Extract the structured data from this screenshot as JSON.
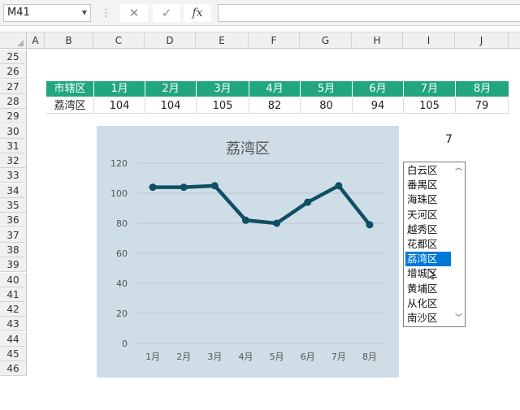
{
  "formula_bar": {
    "name_box": "M41",
    "cancel_glyph": "✕",
    "enter_glyph": "✓",
    "fx_label": "fx",
    "formula": ""
  },
  "columns": [
    "A",
    "B",
    "C",
    "D",
    "E",
    "F",
    "G",
    "H",
    "I",
    "J"
  ],
  "rows": [
    "25",
    "26",
    "27",
    "28",
    "29",
    "30",
    "31",
    "32",
    "33",
    "34",
    "35",
    "36",
    "37",
    "38",
    "39",
    "40",
    "41",
    "42",
    "43",
    "44",
    "45",
    "46"
  ],
  "table": {
    "headers": [
      "市辖区",
      "1月",
      "2月",
      "3月",
      "4月",
      "5月",
      "6月",
      "7月",
      "8月"
    ],
    "row": [
      "荔湾区",
      "104",
      "104",
      "105",
      "82",
      "80",
      "94",
      "105",
      "79"
    ]
  },
  "cell_value": "7",
  "listbox": {
    "items": [
      "白云区",
      "番禺区",
      "海珠区",
      "天河区",
      "越秀区",
      "花都区",
      "荔湾区",
      "增城区",
      "黄埔区",
      "从化区",
      "南沙区"
    ],
    "selected_index": 6
  },
  "colors": {
    "header_green": "#21a67f",
    "line": "#0e4f63",
    "chart_bg": "#cfdde6",
    "selection": "#0078d7"
  },
  "chart_data": {
    "type": "line",
    "title": "荔湾区",
    "categories": [
      "1月",
      "2月",
      "3月",
      "4月",
      "5月",
      "6月",
      "7月",
      "8月"
    ],
    "values": [
      104,
      104,
      105,
      82,
      80,
      94,
      105,
      79
    ],
    "ylim": [
      0,
      120
    ],
    "yticks": [
      0,
      20,
      40,
      60,
      80,
      100,
      120
    ],
    "grid": true,
    "legend": "none"
  }
}
